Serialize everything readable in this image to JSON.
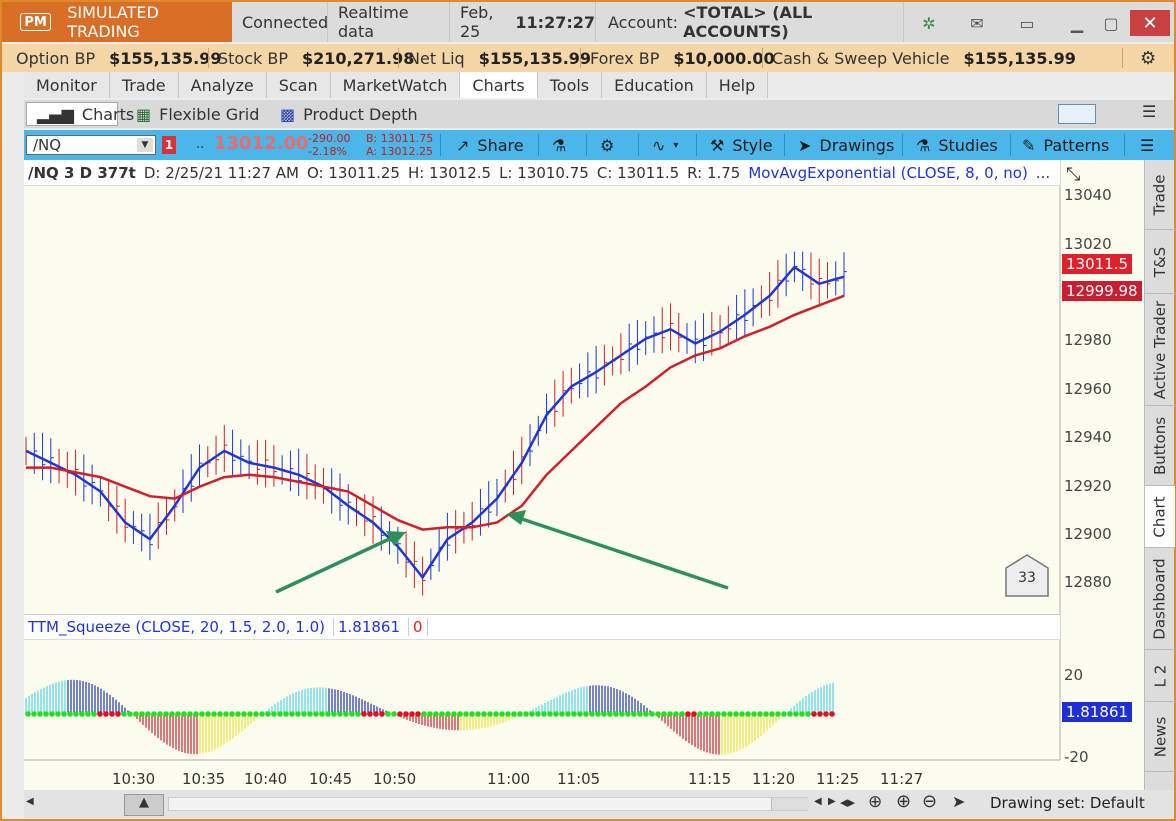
{
  "titlebar": {
    "badge": "PM",
    "mode": "SIMULATED TRADING",
    "connection": "Connected",
    "data_feed": "Realtime data",
    "date": "Feb, 25",
    "time": "11:27:27",
    "account_label": "Account:",
    "account_value": "<TOTAL> (ALL ACCOUNTS)"
  },
  "balances": {
    "option_bp_label": "Option BP",
    "option_bp": "$155,135.99",
    "stock_bp_label": "Stock BP",
    "stock_bp": "$210,271.98",
    "net_liq_label": "Net Liq",
    "net_liq": "$155,135.99",
    "forex_bp_label": "Forex BP",
    "forex_bp": "$10,000.00",
    "cash_label": "Cash & Sweep Vehicle",
    "cash": "$155,135.99"
  },
  "menu": [
    "Monitor",
    "Trade",
    "Analyze",
    "Scan",
    "MarketWatch",
    "Charts",
    "Tools",
    "Education",
    "Help"
  ],
  "subtabs": {
    "charts": "Charts",
    "flexible_grid": "Flexible Grid",
    "product_depth": "Product Depth"
  },
  "toolbar": {
    "symbol": "/NQ",
    "link_badge": "1",
    "dots": "..",
    "last_price": "13012.00",
    "change": "-290.00",
    "change_pct": "-2.18%",
    "bid": "B: 13011.75",
    "ask": "A: 13012.25",
    "share": "Share",
    "style": "Style",
    "drawings": "Drawings",
    "studies": "Studies",
    "patterns": "Patterns"
  },
  "info": {
    "symbol": "/NQ 3 D 377t",
    "date": "D: 2/25/21 11:27 AM",
    "open": "O: 13011.25",
    "high": "H: 13012.5",
    "low": "L: 13010.75",
    "close": "C: 13011.5",
    "range": "R: 1.75",
    "study": "MovAvgExponential (CLOSE, 8, 0, no)",
    "more": "..."
  },
  "squeeze": {
    "label": "TTM_Squeeze (CLOSE, 20, 1.5, 2.0, 1.0)",
    "value": "1.81861",
    "zero": "0",
    "tag": "1.81861",
    "tick_20": "20",
    "tick_m20": "-20"
  },
  "price_axis": {
    "ticks": [
      "13040",
      "13020",
      "13000",
      "12980",
      "12960",
      "12940",
      "12920",
      "12900",
      "12880"
    ],
    "last_tag": "13011.5",
    "ema_tag": "12999.98"
  },
  "time_axis": [
    "10:30",
    "10:35",
    "10:40",
    "10:45",
    "10:50",
    "11:00",
    "11:05",
    "11:15",
    "11:20",
    "11:25",
    "11:27"
  ],
  "bubble": "33",
  "side_tabs": [
    "Trade",
    "T&S",
    "Active Trader",
    "Buttons",
    "Chart",
    "Dashboard",
    "L 2",
    "News"
  ],
  "bottom": {
    "drawing_set": "Drawing set: Default"
  },
  "colors": {
    "ema_fast": "#1f35d8",
    "ema_slow": "#d0202a",
    "arrow": "#2f8f5a",
    "accent": "#d96f26"
  },
  "chart_data": {
    "type": "line",
    "x": [
      "10:26",
      "10:28",
      "10:30",
      "10:32",
      "10:34",
      "10:35",
      "10:37",
      "10:39",
      "10:40",
      "10:42",
      "10:44",
      "10:45",
      "10:47",
      "10:49",
      "10:50",
      "10:52",
      "10:54",
      "10:56",
      "10:58",
      "11:00",
      "11:02",
      "11:04",
      "11:05",
      "11:07",
      "11:09",
      "11:11",
      "11:13",
      "11:15",
      "11:17",
      "11:19",
      "11:20",
      "11:22",
      "11:24",
      "11:25"
    ],
    "series": [
      {
        "values": [
          12935,
          12930,
          12925,
          12918,
          12905,
          12898,
          12912,
          12928,
          12935,
          12930,
          12928,
          12925,
          12920,
          12912,
          12905,
          12895,
          12882,
          12898,
          12905,
          12915,
          12930,
          12950,
          12962,
          12968,
          12975,
          12982,
          12986,
          12980,
          12985,
          12992,
          13000,
          13012,
          13005,
          13008
        ]
      },
      {
        "values": [
          12928,
          12928,
          12926,
          12924,
          12920,
          12916,
          12915,
          12920,
          12924,
          12925,
          12924,
          12922,
          12920,
          12918,
          12912,
          12906,
          12902,
          12903,
          12903,
          12905,
          12912,
          12925,
          12935,
          12945,
          12955,
          12962,
          12970,
          12975,
          12978,
          12983,
          12987,
          12992,
          12996,
          12999.98
        ]
      }
    ],
    "ylim": [
      12870,
      13046
    ]
  }
}
